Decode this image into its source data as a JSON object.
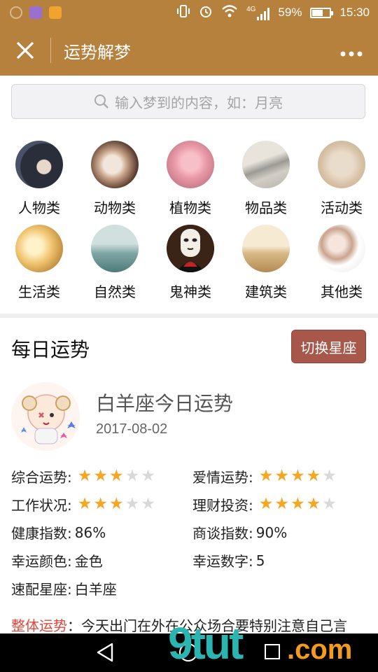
{
  "status_bar": {
    "network": "4G",
    "battery": "59%",
    "battery_level": 0.59,
    "time": "15:30"
  },
  "header": {
    "close_icon": "close-icon",
    "title": "运势解梦",
    "more_icon": "more-dots-icon"
  },
  "search": {
    "placeholder": "输入梦到的内容，如：月亮"
  },
  "categories": [
    {
      "label": "人物类",
      "icon": "person-photo"
    },
    {
      "label": "动物类",
      "icon": "animal-photo"
    },
    {
      "label": "植物类",
      "icon": "flower-photo"
    },
    {
      "label": "物品类",
      "icon": "object-photo"
    },
    {
      "label": "活动类",
      "icon": "activity-sketch"
    },
    {
      "label": "生活类",
      "icon": "life-photo"
    },
    {
      "label": "自然类",
      "icon": "nature-photo"
    },
    {
      "label": "鬼神类",
      "icon": "ghost-mask"
    },
    {
      "label": "建筑类",
      "icon": "building-photo"
    },
    {
      "label": "其他类",
      "icon": "sleep-photo"
    }
  ],
  "daily": {
    "section_title": "每日运势",
    "switch_button": "切换星座",
    "sign_title": "白羊座今日运势",
    "date": "2017-08-02",
    "ratings": [
      {
        "label": "综合运势:",
        "stars": 3,
        "max": 5
      },
      {
        "label": "爱情运势:",
        "stars": 4,
        "max": 5
      },
      {
        "label": "工作状况:",
        "stars": 3,
        "max": 5
      },
      {
        "label": "理财投资:",
        "stars": 4,
        "max": 5
      }
    ],
    "health_label": "健康指数:",
    "health_value": "86%",
    "business_label": "商谈指数:",
    "business_value": "90%",
    "lucky_color_label": "幸运颜色:",
    "lucky_color_value": "金色",
    "lucky_number_label": "幸运数字:",
    "lucky_number_value": "5",
    "match_label": "速配星座:",
    "match_value": "白羊座",
    "overall_key": "整体运势",
    "overall_text": "：今天出门在外在公众场合要特别注意自己言"
  },
  "colors": {
    "brand": "#b6813d",
    "button": "#a8584b",
    "highlight": "#e0463b",
    "star_on": "#f5a623",
    "star_off": "#d9d9d9"
  },
  "watermark": {
    "brand": "9tut",
    "domain": ".com"
  }
}
